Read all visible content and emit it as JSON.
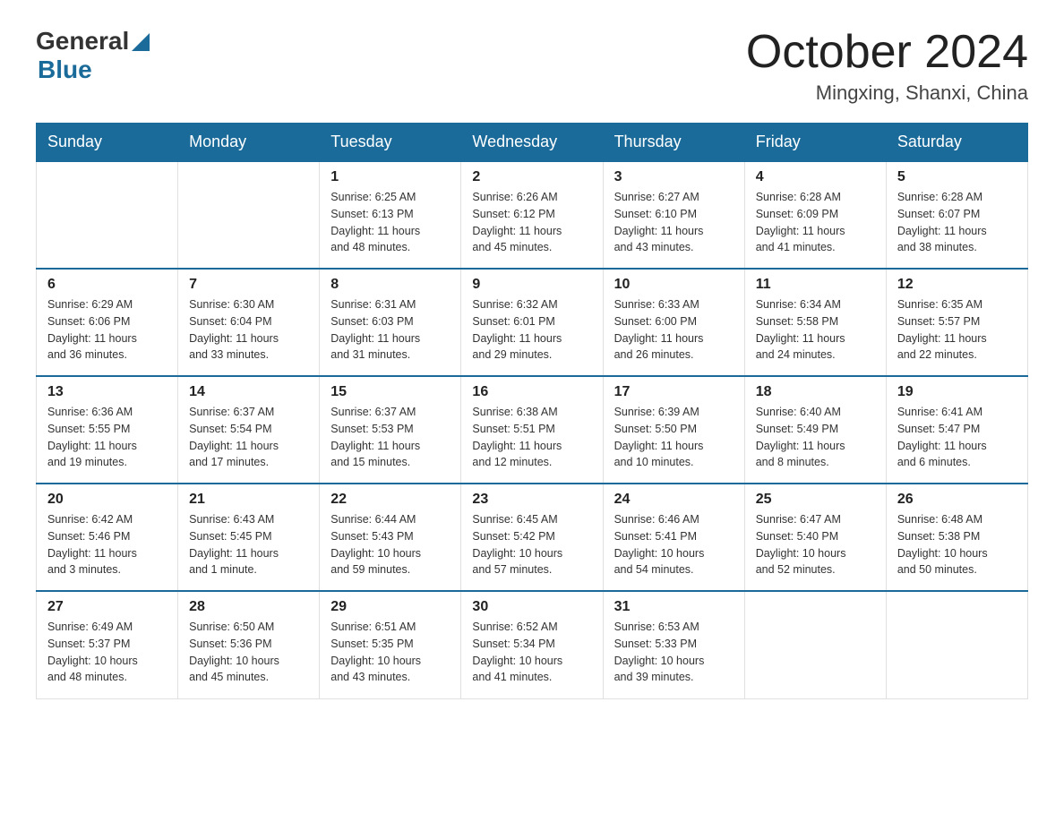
{
  "logo": {
    "general": "General",
    "blue": "Blue"
  },
  "title": {
    "month_year": "October 2024",
    "location": "Mingxing, Shanxi, China"
  },
  "headers": [
    "Sunday",
    "Monday",
    "Tuesday",
    "Wednesday",
    "Thursday",
    "Friday",
    "Saturday"
  ],
  "weeks": [
    [
      {
        "day": "",
        "info": ""
      },
      {
        "day": "",
        "info": ""
      },
      {
        "day": "1",
        "info": "Sunrise: 6:25 AM\nSunset: 6:13 PM\nDaylight: 11 hours\nand 48 minutes."
      },
      {
        "day": "2",
        "info": "Sunrise: 6:26 AM\nSunset: 6:12 PM\nDaylight: 11 hours\nand 45 minutes."
      },
      {
        "day": "3",
        "info": "Sunrise: 6:27 AM\nSunset: 6:10 PM\nDaylight: 11 hours\nand 43 minutes."
      },
      {
        "day": "4",
        "info": "Sunrise: 6:28 AM\nSunset: 6:09 PM\nDaylight: 11 hours\nand 41 minutes."
      },
      {
        "day": "5",
        "info": "Sunrise: 6:28 AM\nSunset: 6:07 PM\nDaylight: 11 hours\nand 38 minutes."
      }
    ],
    [
      {
        "day": "6",
        "info": "Sunrise: 6:29 AM\nSunset: 6:06 PM\nDaylight: 11 hours\nand 36 minutes."
      },
      {
        "day": "7",
        "info": "Sunrise: 6:30 AM\nSunset: 6:04 PM\nDaylight: 11 hours\nand 33 minutes."
      },
      {
        "day": "8",
        "info": "Sunrise: 6:31 AM\nSunset: 6:03 PM\nDaylight: 11 hours\nand 31 minutes."
      },
      {
        "day": "9",
        "info": "Sunrise: 6:32 AM\nSunset: 6:01 PM\nDaylight: 11 hours\nand 29 minutes."
      },
      {
        "day": "10",
        "info": "Sunrise: 6:33 AM\nSunset: 6:00 PM\nDaylight: 11 hours\nand 26 minutes."
      },
      {
        "day": "11",
        "info": "Sunrise: 6:34 AM\nSunset: 5:58 PM\nDaylight: 11 hours\nand 24 minutes."
      },
      {
        "day": "12",
        "info": "Sunrise: 6:35 AM\nSunset: 5:57 PM\nDaylight: 11 hours\nand 22 minutes."
      }
    ],
    [
      {
        "day": "13",
        "info": "Sunrise: 6:36 AM\nSunset: 5:55 PM\nDaylight: 11 hours\nand 19 minutes."
      },
      {
        "day": "14",
        "info": "Sunrise: 6:37 AM\nSunset: 5:54 PM\nDaylight: 11 hours\nand 17 minutes."
      },
      {
        "day": "15",
        "info": "Sunrise: 6:37 AM\nSunset: 5:53 PM\nDaylight: 11 hours\nand 15 minutes."
      },
      {
        "day": "16",
        "info": "Sunrise: 6:38 AM\nSunset: 5:51 PM\nDaylight: 11 hours\nand 12 minutes."
      },
      {
        "day": "17",
        "info": "Sunrise: 6:39 AM\nSunset: 5:50 PM\nDaylight: 11 hours\nand 10 minutes."
      },
      {
        "day": "18",
        "info": "Sunrise: 6:40 AM\nSunset: 5:49 PM\nDaylight: 11 hours\nand 8 minutes."
      },
      {
        "day": "19",
        "info": "Sunrise: 6:41 AM\nSunset: 5:47 PM\nDaylight: 11 hours\nand 6 minutes."
      }
    ],
    [
      {
        "day": "20",
        "info": "Sunrise: 6:42 AM\nSunset: 5:46 PM\nDaylight: 11 hours\nand 3 minutes."
      },
      {
        "day": "21",
        "info": "Sunrise: 6:43 AM\nSunset: 5:45 PM\nDaylight: 11 hours\nand 1 minute."
      },
      {
        "day": "22",
        "info": "Sunrise: 6:44 AM\nSunset: 5:43 PM\nDaylight: 10 hours\nand 59 minutes."
      },
      {
        "day": "23",
        "info": "Sunrise: 6:45 AM\nSunset: 5:42 PM\nDaylight: 10 hours\nand 57 minutes."
      },
      {
        "day": "24",
        "info": "Sunrise: 6:46 AM\nSunset: 5:41 PM\nDaylight: 10 hours\nand 54 minutes."
      },
      {
        "day": "25",
        "info": "Sunrise: 6:47 AM\nSunset: 5:40 PM\nDaylight: 10 hours\nand 52 minutes."
      },
      {
        "day": "26",
        "info": "Sunrise: 6:48 AM\nSunset: 5:38 PM\nDaylight: 10 hours\nand 50 minutes."
      }
    ],
    [
      {
        "day": "27",
        "info": "Sunrise: 6:49 AM\nSunset: 5:37 PM\nDaylight: 10 hours\nand 48 minutes."
      },
      {
        "day": "28",
        "info": "Sunrise: 6:50 AM\nSunset: 5:36 PM\nDaylight: 10 hours\nand 45 minutes."
      },
      {
        "day": "29",
        "info": "Sunrise: 6:51 AM\nSunset: 5:35 PM\nDaylight: 10 hours\nand 43 minutes."
      },
      {
        "day": "30",
        "info": "Sunrise: 6:52 AM\nSunset: 5:34 PM\nDaylight: 10 hours\nand 41 minutes."
      },
      {
        "day": "31",
        "info": "Sunrise: 6:53 AM\nSunset: 5:33 PM\nDaylight: 10 hours\nand 39 minutes."
      },
      {
        "day": "",
        "info": ""
      },
      {
        "day": "",
        "info": ""
      }
    ]
  ]
}
